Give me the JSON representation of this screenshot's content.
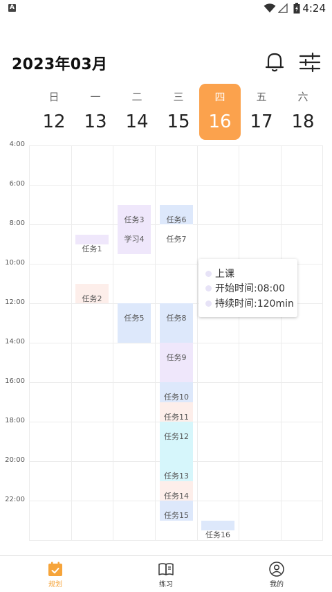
{
  "status_bar": {
    "time": "4:24",
    "notification_icon": "a-box-icon",
    "wifi_icon": "wifi-icon",
    "signal_icon": "signal-icon",
    "battery_icon": "battery-icon"
  },
  "header": {
    "title": "2023年03月",
    "bell_icon": "bell-icon",
    "filter_icon": "sliders-icon"
  },
  "week": [
    {
      "weekday": "日",
      "date": "12"
    },
    {
      "weekday": "一",
      "date": "13"
    },
    {
      "weekday": "二",
      "date": "14"
    },
    {
      "weekday": "三",
      "date": "15"
    },
    {
      "weekday": "四",
      "date": "16",
      "selected": true
    },
    {
      "weekday": "五",
      "date": "17"
    },
    {
      "weekday": "六",
      "date": "18"
    }
  ],
  "time_labels": [
    "4:00",
    "6:00",
    "8:00",
    "10:00",
    "12:00",
    "14:00",
    "16:00",
    "18:00",
    "20:00",
    "22:00"
  ],
  "events": [
    {
      "name": "任务1",
      "day": "一",
      "start": "8:30",
      "end": "9:00",
      "color": "#efe7fb"
    },
    {
      "name": "任务2",
      "day": "一",
      "start": "11:00",
      "end": "12:00",
      "color": "#fdeeea"
    },
    {
      "name": "任务3",
      "day": "二",
      "start": "7:00",
      "end": "8:15",
      "color": "#efe7fb"
    },
    {
      "name": "学习4",
      "day": "二",
      "start": "8:15",
      "end": "9:30",
      "color": "#efe7fb"
    },
    {
      "name": "任务5",
      "day": "二",
      "start": "12:00",
      "end": "14:00",
      "color": "#dde8fb"
    },
    {
      "name": "任务6",
      "day": "三",
      "start": "7:00",
      "end": "8:00",
      "color": "#dde8fb"
    },
    {
      "name": "任务7",
      "day": "三",
      "start": "8:00",
      "end": "9:00",
      "color": "#ffffff"
    },
    {
      "name": "任务8",
      "day": "三",
      "start": "12:00",
      "end": "14:00",
      "color": "#dde8fb"
    },
    {
      "name": "任务9",
      "day": "三",
      "start": "14:00",
      "end": "16:00",
      "color": "#efe7fb"
    },
    {
      "name": "任务10",
      "day": "三",
      "start": "16:00",
      "end": "17:00",
      "color": "#dde8fb"
    },
    {
      "name": "任务11",
      "day": "三",
      "start": "17:00",
      "end": "18:00",
      "color": "#fdeeea"
    },
    {
      "name": "任务12",
      "day": "三",
      "start": "18:00",
      "end": "21:00",
      "color": "#d6f6fb"
    },
    {
      "name": "任务13",
      "day": "三",
      "start": "21:00",
      "end": "21:00",
      "color": "#d6f6fb"
    },
    {
      "name": "任务14",
      "day": "三",
      "start": "21:00",
      "end": "22:00",
      "color": "#fdeeea"
    },
    {
      "name": "任务15",
      "day": "三",
      "start": "22:00",
      "end": "23:00",
      "color": "#dde8fb"
    },
    {
      "name": "任务16",
      "day": "四",
      "start": "23:00",
      "end": "23:30",
      "color": "#dde8fb"
    }
  ],
  "popup": {
    "title": "上课",
    "start_time": "开始时间:08:00",
    "duration": "持续时间:120min"
  },
  "tabbar": [
    {
      "label": "规划",
      "icon": "calendar-check-icon",
      "active": true
    },
    {
      "label": "练习",
      "icon": "book-icon",
      "active": false
    },
    {
      "label": "我的",
      "icon": "user-circle-icon",
      "active": false
    }
  ],
  "colors": {
    "accent": "#fba24d",
    "tab_active": "#f6a43a"
  }
}
